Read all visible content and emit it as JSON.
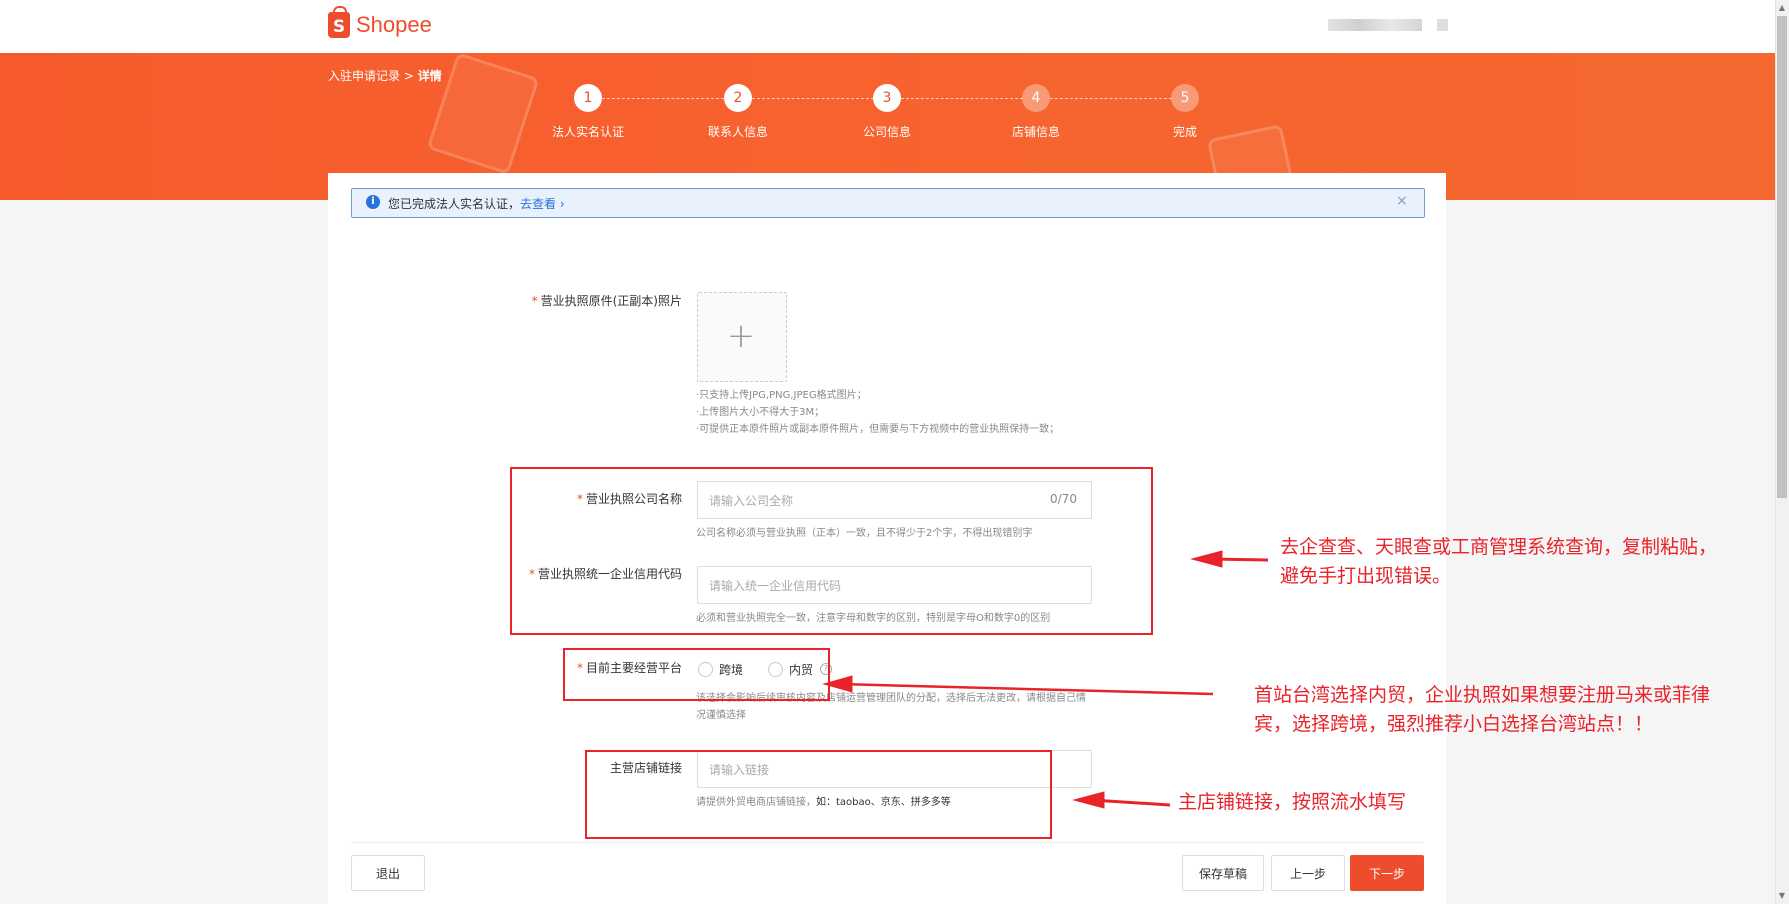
{
  "brand": {
    "name": "Shopee",
    "logo_letter": "S"
  },
  "breadcrumb": {
    "parent": "入驻申请记录",
    "separator": ">",
    "current": "详情"
  },
  "steps": [
    {
      "number": "1",
      "label": "法人实名认证",
      "state": "done"
    },
    {
      "number": "2",
      "label": "联系人信息",
      "state": "done"
    },
    {
      "number": "3",
      "label": "公司信息",
      "state": "current"
    },
    {
      "number": "4",
      "label": "店铺信息",
      "state": "todo"
    },
    {
      "number": "5",
      "label": "完成",
      "state": "todo"
    }
  ],
  "notice": {
    "icon": "info-icon",
    "text": "您已完成法人实名认证，",
    "link": "去查看",
    "link_arrow": "›",
    "close": "×"
  },
  "form": {
    "license_photo": {
      "label": "营业执照原件(正副本)照片",
      "upload_plus": "+",
      "hints": [
        "·只支持上传JPG,PNG,JPEG格式图片；",
        "·上传图片大小不得大于3M；",
        "·可提供正本原件照片或副本原件照片，但需要与下方视频中的营业执照保持一致；"
      ]
    },
    "company_name": {
      "label": "营业执照公司名称",
      "placeholder": "请输入公司全称",
      "counter": "0/70",
      "hint": "公司名称必须与营业执照（正本）一致，且不得少于2个字，不得出现错别字"
    },
    "credit_code": {
      "label": "营业执照统一企业信用代码",
      "placeholder": "请输入统一企业信用代码",
      "hint": "必须和营业执照完全一致，注意字母和数字的区别，特别是字母O和数字0的区别"
    },
    "platform": {
      "label": "目前主要经营平台",
      "options": [
        "跨境",
        "内贸"
      ],
      "help_icon": "?",
      "hint": "该选择会影响后续审核内容及店铺运营管理团队的分配，选择后无法更改，请根据自己情况谨慎选择"
    },
    "store_link": {
      "label": "主营店铺链接",
      "placeholder": "请输入链接",
      "hint_prefix": "请提供外贸电商店铺链接，",
      "hint_example": "如：taobao、京东、拼多多等"
    }
  },
  "annotations": {
    "note1": [
      "去企查查、天眼查或工商管理系统查询，复制粘贴，",
      "避免手打出现错误。"
    ],
    "note2": [
      "首站台湾选择内贸，企业执照如果想要注册马来或菲律",
      "宾，选择跨境，强烈推荐小白选择台湾站点！！"
    ],
    "note3": [
      "主店铺链接，按照流水填写"
    ],
    "color": "#e8232a"
  },
  "footer": {
    "exit": "退出",
    "save_draft": "保存草稿",
    "prev": "上一步",
    "next": "下一步"
  },
  "colors": {
    "brand": "#ee4d2d",
    "banner": "#f65a2c",
    "link": "#2673dd"
  }
}
